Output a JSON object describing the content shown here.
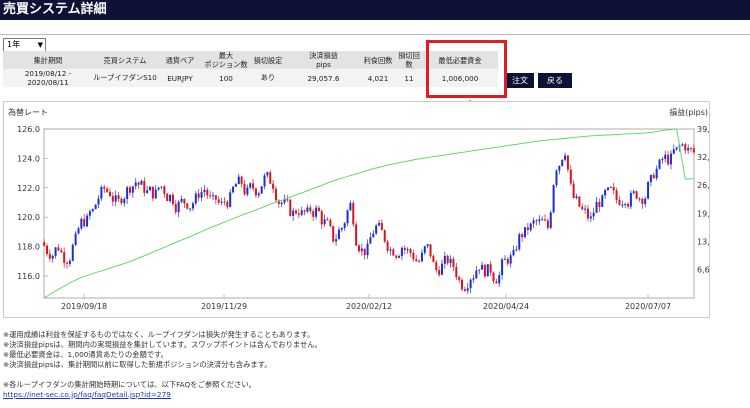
{
  "window": {
    "title": "売買システム詳細"
  },
  "period_select": {
    "value": "1年"
  },
  "table": {
    "headers": [
      "集計期間",
      "売買システム",
      "通貨ペア",
      "最大\nポジション数",
      "損切設定",
      "決済損益\npips",
      "利食回数",
      "損切回数",
      "最低必要資金"
    ],
    "row": [
      "2019/08/12 - 2020/08/11",
      "ループイフダンS10",
      "EURJPY",
      "100",
      "あり",
      "29,057.6",
      "4,021",
      "11",
      "1,006,000"
    ]
  },
  "buttons": {
    "order": "注文",
    "back": "戻る"
  },
  "annotation": {
    "colors": {
      "highlight": "#e31b23"
    }
  },
  "chart": {
    "left_label": "為替レート",
    "right_label": "損益(pips)"
  },
  "chart_data": {
    "type": "line",
    "title": "",
    "xlabel": "",
    "ylabel": "為替レート",
    "y2label": "損益(pips)",
    "x_ticks": [
      "2019/09/18",
      "2019/11/29",
      "2020/02/12",
      "2020/04/24",
      "2020/07/07"
    ],
    "y_ticks": [
      "116.0",
      "118.0",
      "120.0",
      "122.0",
      "124.0",
      "126.0"
    ],
    "y2_ticks": [
      "6,604.5",
      "13,101.8",
      "19,599.1",
      "26,096.4",
      "32,593.7",
      "39,091.0"
    ],
    "ylim": [
      114.5,
      126.0
    ],
    "y2lim": [
      0,
      39091.0
    ],
    "series": [
      {
        "type": "candlestick",
        "close": [
          117.6,
          118.0,
          117.2,
          118.4,
          119.8,
          120.4,
          121.6,
          121.7,
          121.0,
          121.8,
          122.4,
          122.0,
          121.7,
          122.1,
          121.4,
          120.8,
          121.0,
          121.2,
          121.9,
          121.0,
          120.8,
          121.2,
          122.3,
          121.6,
          121.9,
          122.6,
          122.3,
          121.0,
          120.5,
          120.5,
          120.2,
          120.4,
          119.6,
          118.6,
          119.3,
          120.8,
          118.1,
          117.7,
          119.3,
          118.6,
          117.8,
          118.0,
          117.6,
          117.0,
          117.9,
          116.4,
          116.9,
          116.7,
          115.5,
          116.0,
          116.8,
          116.3,
          115.9,
          117.0,
          117.3,
          118.9,
          119.3,
          119.6,
          119.3,
          123.5,
          124.6,
          121.3,
          120.4,
          119.8,
          121.1,
          121.6,
          121.2,
          121.4,
          121.5,
          121.4,
          122.4,
          123.5,
          124.0,
          124.5,
          124.9,
          124.4
        ],
        "colors": {
          "up": "#1a2dd8",
          "down": "#d8141e"
        }
      },
      {
        "name": "損益",
        "type": "line",
        "color": "#54d65a",
        "values": [
          0,
          1200,
          2400,
          3500,
          4500,
          5200,
          5900,
          6500,
          7200,
          7800,
          8500,
          9300,
          10100,
          11000,
          11800,
          12700,
          13500,
          14300,
          15200,
          16100,
          16900,
          17700,
          18500,
          19300,
          20000,
          20800,
          21600,
          22300,
          23000,
          23800,
          24500,
          25300,
          26000,
          26800,
          27500,
          28100,
          28700,
          29300,
          29900,
          30400,
          30900,
          31300,
          31700,
          32100,
          32400,
          32700,
          33000,
          33300,
          33600,
          33900,
          34200,
          34500,
          34800,
          35100,
          35400,
          35700,
          36000,
          36300,
          36500,
          36700,
          36900,
          37100,
          37300,
          37500,
          37600,
          37700,
          37800,
          37900,
          38000,
          38100,
          38300,
          38600,
          38900,
          39091,
          27500,
          27600
        ]
      }
    ]
  },
  "notes": [
    "※運用成績は利益を保証するものではなく、ループイフダンは損失が発生することもあります。",
    "※決済損益pipsは、期間内の実現損益を集計しています。スワップポイントは含んでおりません。",
    "※最低必要資金は、1,000通貨あたりの金額です。",
    "※決済損益pipsは、集計期間以前に取得した新規ポジションの決済分も含みます。",
    "",
    "※各ループイフダンの集計開始時期については、以下FAQをご参照ください。"
  ],
  "faq_link": "https://inet-sec.co.jp/faq/faqDetail.jsp?id=279"
}
